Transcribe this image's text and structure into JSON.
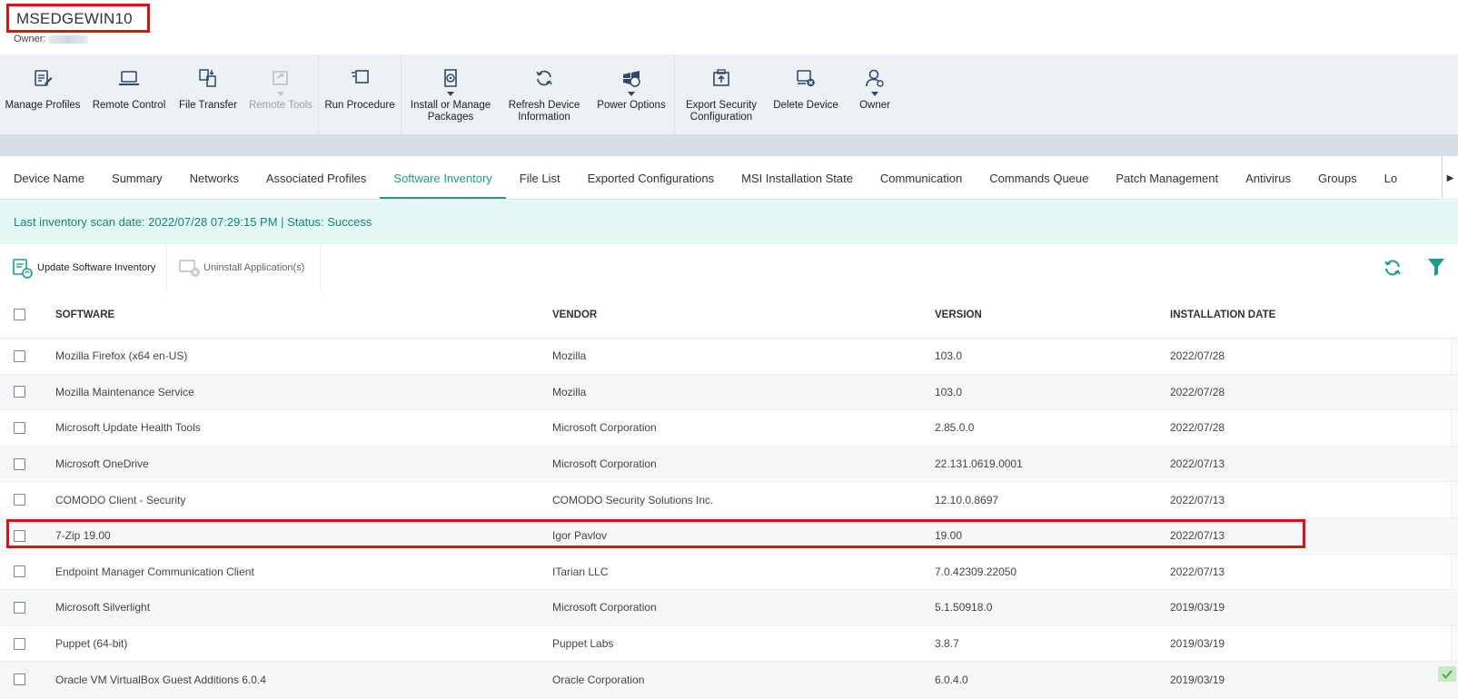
{
  "device": {
    "name": "MSEDGEWIN10",
    "owner_label": "Owner:"
  },
  "toolbar": {
    "buttons": [
      {
        "label": "Manage Profiles",
        "icon": "manage-profiles-icon"
      },
      {
        "label": "Remote Control",
        "icon": "laptop-icon"
      },
      {
        "label": "File Transfer",
        "icon": "file-transfer-icon"
      },
      {
        "label": "Remote Tools",
        "icon": "remote-tools-icon",
        "disabled": true
      },
      {
        "label": "Run Procedure",
        "icon": "run-procedure-icon"
      },
      {
        "label": "Install or Manage\nPackages",
        "icon": "package-icon"
      },
      {
        "label": "Refresh Device\nInformation",
        "icon": "refresh-icon"
      },
      {
        "label": "Power Options",
        "icon": "power-options-icon"
      },
      {
        "label": "Export Security\nConfiguration",
        "icon": "export-config-icon"
      },
      {
        "label": "Delete Device",
        "icon": "delete-device-icon"
      },
      {
        "label": "Owner",
        "icon": "owner-icon"
      }
    ]
  },
  "tabs": [
    {
      "label": "Device Name"
    },
    {
      "label": "Summary"
    },
    {
      "label": "Networks"
    },
    {
      "label": "Associated Profiles"
    },
    {
      "label": "Software Inventory",
      "active": true
    },
    {
      "label": "File List"
    },
    {
      "label": "Exported Configurations"
    },
    {
      "label": "MSI Installation State"
    },
    {
      "label": "Communication"
    },
    {
      "label": "Commands Queue"
    },
    {
      "label": "Patch Management"
    },
    {
      "label": "Antivirus"
    },
    {
      "label": "Groups"
    },
    {
      "label": "Lo"
    }
  ],
  "status_banner": "Last inventory scan date: 2022/07/28 07:29:15 PM | Status: Success",
  "actions": {
    "update_label": "Update Software Inventory",
    "uninstall_label": "Uninstall Application(s)"
  },
  "colors": {
    "accent": "#1f9b8b",
    "highlight": "#e01010"
  },
  "table": {
    "headers": {
      "software": "SOFTWARE",
      "vendor": "VENDOR",
      "version": "VERSION",
      "installation_date": "INSTALLATION DATE"
    },
    "rows": [
      {
        "software": "Mozilla Firefox (x64 en-US)",
        "vendor": "Mozilla",
        "version": "103.0",
        "date": "2022/07/28"
      },
      {
        "software": "Mozilla Maintenance Service",
        "vendor": "Mozilla",
        "version": "103.0",
        "date": "2022/07/28"
      },
      {
        "software": "Microsoft Update Health Tools",
        "vendor": "Microsoft Corporation",
        "version": "2.85.0.0",
        "date": "2022/07/28"
      },
      {
        "software": "Microsoft OneDrive",
        "vendor": "Microsoft Corporation",
        "version": "22.131.0619.0001",
        "date": "2022/07/13"
      },
      {
        "software": "COMODO Client - Security",
        "vendor": "COMODO Security Solutions Inc.",
        "version": "12.10.0.8697",
        "date": "2022/07/13"
      },
      {
        "software": "7-Zip 19.00",
        "vendor": "Igor Pavlov",
        "version": "19.00",
        "date": "2022/07/13"
      },
      {
        "software": "Endpoint Manager Communication Client",
        "vendor": "ITarian LLC",
        "version": "7.0.42309.22050",
        "date": "2022/07/13"
      },
      {
        "software": "Microsoft Silverlight",
        "vendor": "Microsoft Corporation",
        "version": "5.1.50918.0",
        "date": "2019/03/19"
      },
      {
        "software": "Puppet (64-bit)",
        "vendor": "Puppet Labs",
        "version": "3.8.7",
        "date": "2019/03/19"
      },
      {
        "software": "Oracle VM VirtualBox Guest Additions 6.0.4",
        "vendor": "Oracle Corporation",
        "version": "6.0.4.0",
        "date": "2019/03/19"
      }
    ]
  }
}
